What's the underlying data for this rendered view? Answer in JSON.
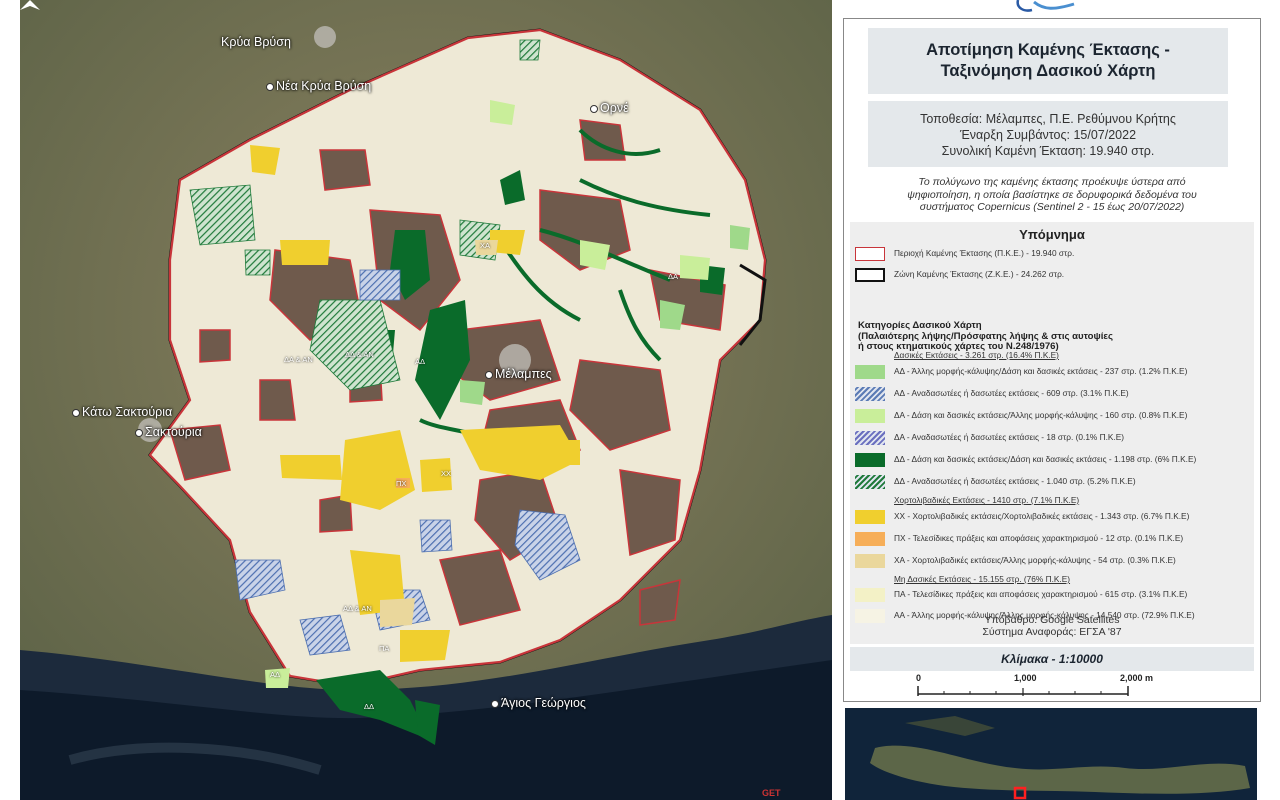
{
  "map": {
    "places": [
      {
        "name": "Κρύα Βρύση",
        "dot": false
      },
      {
        "name": "Νέα Κρύα Βρύση",
        "dot": true
      },
      {
        "name": "Ορνέ",
        "dot": true
      },
      {
        "name": "Μέλαμπες",
        "dot": true
      },
      {
        "name": "Κάτω Σακτούρια",
        "dot": true
      },
      {
        "name": "Σακτούρια",
        "dot": true
      },
      {
        "name": "Άγιος Γεώργιος",
        "dot": true
      }
    ],
    "labels": [
      "ΧΑ",
      "ΔΑ",
      "ΔΑ & ΑΝ",
      "ΔΔ & ΑΝ",
      "ΑΔ",
      "ΠΧ",
      "ΧΧ",
      "ΑΔ & ΑΝ",
      "ΠΑ",
      "ΑΔ",
      "ΔΔ"
    ],
    "watermark": "GET"
  },
  "panel": {
    "title_line1": "Αποτίμηση Καμένης Έκτασης -",
    "title_line2": "Ταξινόμηση Δασικού Χάρτη",
    "location": "Τοποθεσία: Μέλαμπες, Π.Ε. Ρεθύμνου Κρήτης",
    "start": "Έναρξη Συμβάντος: 15/07/2022",
    "area": "Συνολική Καμένη Έκταση: 19.940 στρ.",
    "note_line1": "Το πολύγωνο της καμένης έκτασης προέκυψε ύστερα από",
    "note_line2": "ψηφιοποίηση, η οποία βασίστηκε σε δορυφορικά δεδομένα του",
    "note_line3": "συστήματος Copernicus (Sentinel 2 - 15 έως 20/07/2022)",
    "legend_title": "Υπόμνημα",
    "pke": "Περιοχή Καμένης Έκτασης (Π.Κ.Ε.) - 19.940 στρ.",
    "zke": "Ζώνη Καμένης Έκτασης (Ζ.Κ.Ε.) - 24.262 στρ.",
    "cat_line1": "Κατηγορίες Δασικού Χάρτη",
    "cat_line2": "(Παλαιότερης λήψης/Πρόσφατης λήψης & στις αυτοψίες",
    "cat_line3": "ή στους κτηματικούς χάρτες του Ν.248/1976)",
    "groups": [
      {
        "head": "Δασικές Εκτάσεις - 3.261 στρ. (16.4% Π.Κ.Ε)",
        "items": [
          {
            "label": "ΑΔ - Άλλης μορφής-κάλυψης/Δάση και δασικές εκτάσεις - 237 στρ. (1.2% Π.Κ.Ε)",
            "color": "#9fd98a",
            "hatch": false
          },
          {
            "label": "ΑΔ - Αναδασωτέες ή δασωτέες εκτάσεις - 609 στρ. (3.1% Π.Κ.Ε)",
            "color": "#5b7bb5",
            "hatch": true
          },
          {
            "label": "ΔΑ - Δάση και δασικές εκτάσεις/Άλλης μορφής-κάλυψης - 160 στρ. (0.8% Π.Κ.Ε)",
            "color": "#c9ee9a",
            "hatch": false
          },
          {
            "label": "ΔΑ - Αναδασωτέες ή δασωτέες εκτάσεις - 18 στρ. (0.1% Π.Κ.Ε)",
            "color": "#6a6fbf",
            "hatch": true
          },
          {
            "label": "ΔΔ - Δάση και δασικές εκτάσεις/Δάση και δασικές εκτάσεις - 1.198 στρ. (6% Π.Κ.Ε)",
            "color": "#0a6b2a",
            "hatch": false
          },
          {
            "label": "ΔΔ - Αναδασωτέες ή δασωτέες εκτάσεις - 1.040 στρ. (5.2% Π.Κ.Ε)",
            "color": "#1f7a3a",
            "hatch": true
          }
        ]
      },
      {
        "head": "Χορτολιβαδικές Εκτάσεις - 1410 στρ. (7.1% Π.Κ.Ε)",
        "items": [
          {
            "label": "ΧΧ - Χορτολιβαδικές εκτάσεις/Χορτολιβαδικές εκτάσεις - 1.343 στρ. (6.7% Π.Κ.Ε)",
            "color": "#f0cf2e",
            "hatch": false
          },
          {
            "label": "ΠΧ - Τελεσίδικες πράξεις και αποφάσεις χαρακτηρισμού - 12 στρ. (0.1% Π.Κ.Ε)",
            "color": "#f6ae58",
            "hatch": false
          },
          {
            "label": "ΧΑ - Χορτολιβαδικές εκτάσεις/Άλλης μορφής-κάλυψης - 54 στρ. (0.3% Π.Κ.Ε)",
            "color": "#ead79c",
            "hatch": false
          }
        ]
      },
      {
        "head": "Μη Δασικές Εκτάσεις - 15.155 στρ. (76% Π.Κ.Ε)",
        "items": [
          {
            "label": "ΠΑ - Τελεσίδικες πράξεις και αποφάσεις χαρακτηρισμού - 615 στρ. (3.1% Π.Κ.Ε)",
            "color": "#f3f1c6",
            "hatch": false
          },
          {
            "label": "ΑΑ - Άλλης μορφής-κάλυψης/Άλλης μορφής-κάλυψης - 14.540 στρ. (72.9% Π.Κ.Ε)",
            "color": "#f6f3e4",
            "hatch": false
          }
        ]
      }
    ],
    "basemap": "Υπόβαθρο: Google Satellites",
    "crs": "Σύστημα Αναφοράς: ΕΓΣΑ '87",
    "scale": "Κλίμακα - 1:10000",
    "scale_ticks": [
      "0",
      "1,000",
      "2,000 m"
    ]
  }
}
